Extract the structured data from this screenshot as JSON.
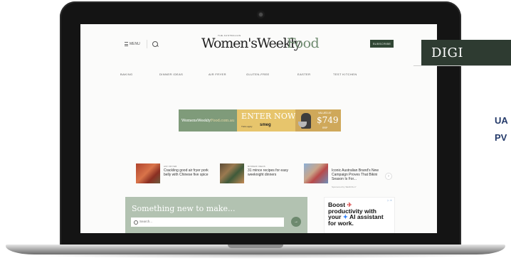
{
  "site": {
    "logo_tagline": "THE AUSTRALIAN",
    "logo_primary": "Women'sWeekly",
    "logo_secondary": "Food",
    "menu_label": "MENU",
    "subscribe_label": "SUBSCRIBE"
  },
  "nav": {
    "items": [
      "BAKING",
      "DINNER IDEAS",
      "AIR FRYER",
      "GLUTEN-FREE",
      "EASTER",
      "TEST KITCHEN"
    ]
  },
  "banner": {
    "brand_text": "WomensWeekly",
    "brand_suffix": "Food.com.au",
    "cta": "ENTER NOW",
    "sponsor": "smeg",
    "small_print": "T&Cs apply",
    "valued_label": "VALUED AT",
    "price": "$749",
    "rrp": "RRP"
  },
  "cards": [
    {
      "category": "AIR FRYER",
      "title": "Crackling good air fryer pork belly with Chinese five spice",
      "sponsored": ""
    },
    {
      "category": "DINNER IDEAS",
      "title": "31 mince recipes for easy weeknight dinners",
      "sponsored": ""
    },
    {
      "category": "",
      "title": "Iconic Australian Brand's New Campaign Proves That Bikini Season Is For...",
      "sponsored": "Sponsored by SEAFOLLY"
    }
  ],
  "new_recipes": {
    "heading": "Something new to make...",
    "search_placeholder": "Search...",
    "go": "→"
  },
  "ad": {
    "adchoices": "▷ ✕",
    "copy_line1": "Boost",
    "copy_line2": "productivity with",
    "copy_line3": "your",
    "copy_spark": "✦",
    "copy_line3b": "AI assistant",
    "copy_line4": "for work."
  },
  "promo": {
    "title": "DIGI",
    "line1": "UA",
    "line2": "PV"
  },
  "colors": {
    "accent_green": "#6e8a6f",
    "dark_green": "#304634",
    "banner_gold": "#e7c56c"
  }
}
